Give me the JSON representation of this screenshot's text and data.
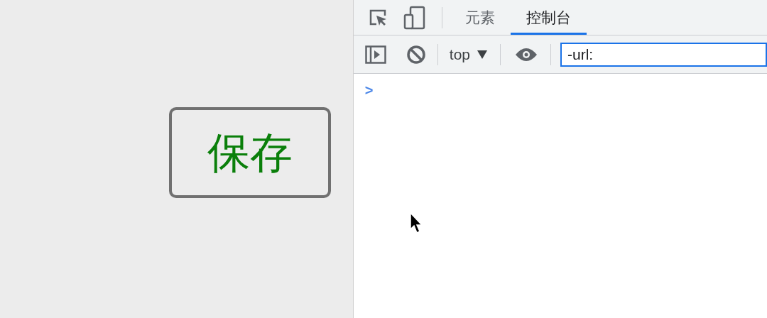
{
  "page": {
    "button_label": "保存"
  },
  "devtools": {
    "tabs": [
      {
        "label": "元素",
        "selected": false
      },
      {
        "label": "控制台",
        "selected": true
      }
    ],
    "context": "top",
    "filter": {
      "value": "-url:"
    },
    "prompt": ">"
  }
}
